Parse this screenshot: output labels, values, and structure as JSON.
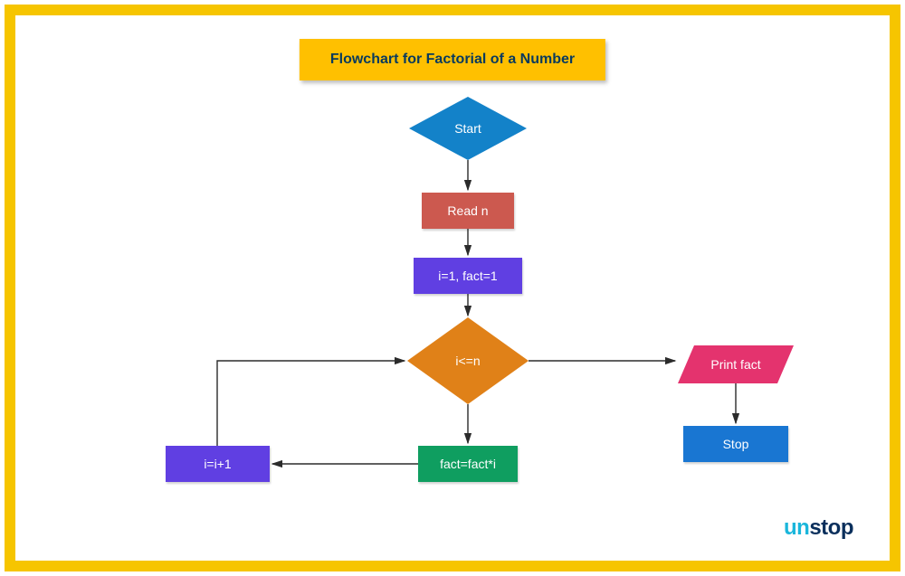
{
  "title": "Flowchart for Factorial of a Number",
  "nodes": {
    "start": "Start",
    "read": "Read n",
    "init": "i=1, fact=1",
    "decision": "i<=n",
    "print": "Print fact",
    "stop": "Stop",
    "fact_step": "fact=fact*i",
    "increment": "i=i+1"
  },
  "logo": {
    "prefix": "un",
    "suffix": "stop"
  },
  "chart_data": {
    "type": "flowchart",
    "title": "Flowchart for Factorial of a Number",
    "nodes": [
      {
        "id": "start",
        "shape": "diamond",
        "label": "Start",
        "color": "#1382c9"
      },
      {
        "id": "read",
        "shape": "rectangle",
        "label": "Read n",
        "color": "#cc594f"
      },
      {
        "id": "init",
        "shape": "rectangle",
        "label": "i=1, fact=1",
        "color": "#603fe2"
      },
      {
        "id": "decision",
        "shape": "diamond",
        "label": "i<=n",
        "color": "#e08118"
      },
      {
        "id": "print",
        "shape": "parallelogram",
        "label": "Print fact",
        "color": "#e4336e"
      },
      {
        "id": "stop",
        "shape": "rectangle",
        "label": "Stop",
        "color": "#1976d2"
      },
      {
        "id": "fact_step",
        "shape": "rectangle",
        "label": "fact=fact*i",
        "color": "#0f9e60"
      },
      {
        "id": "increment",
        "shape": "rectangle",
        "label": "i=i+1",
        "color": "#603fe2"
      }
    ],
    "edges": [
      {
        "from": "start",
        "to": "read"
      },
      {
        "from": "read",
        "to": "init"
      },
      {
        "from": "init",
        "to": "decision"
      },
      {
        "from": "decision",
        "to": "fact_step",
        "branch": "true"
      },
      {
        "from": "decision",
        "to": "print",
        "branch": "false"
      },
      {
        "from": "print",
        "to": "stop"
      },
      {
        "from": "fact_step",
        "to": "increment"
      },
      {
        "from": "increment",
        "to": "decision"
      }
    ]
  }
}
